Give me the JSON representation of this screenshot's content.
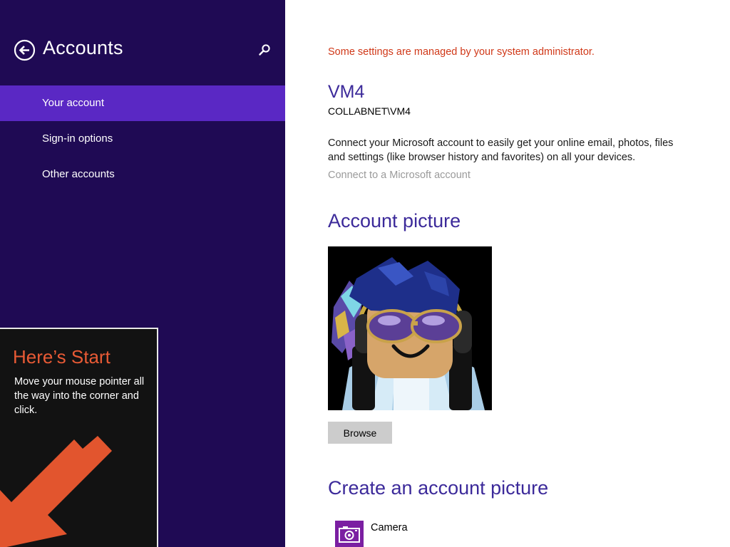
{
  "nav": {
    "title": "Accounts",
    "back_icon": "back-arrow-circle-icon",
    "search_icon": "search-icon",
    "items": [
      {
        "label": "Your account",
        "selected": true
      },
      {
        "label": "Sign-in options",
        "selected": false
      },
      {
        "label": "Other accounts",
        "selected": false
      }
    ]
  },
  "start_tip": {
    "title": "Here’s Start",
    "body": "Move your mouse pointer all the way into the corner and click.",
    "arrow_icon": "arrow-down-left-icon"
  },
  "account": {
    "admin_notice": "Some settings are managed by your system administrator.",
    "display_name": "VM4",
    "domain_user": "COLLABNET\\VM4",
    "connect_description": "Connect your Microsoft account to easily get your online email, photos, files and settings (like browser history and favorites) on all your devices.",
    "connect_link": "Connect to a Microsoft account"
  },
  "picture_section": {
    "heading": "Account picture",
    "browse_label": "Browse"
  },
  "create_section": {
    "heading": "Create an account picture",
    "camera_label": "Camera",
    "camera_icon": "camera-icon"
  },
  "colors": {
    "nav_background": "#1f0a54",
    "nav_selected": "#5a28c4",
    "accent_heading": "#3c2a9a",
    "admin_notice": "#d03818",
    "start_tip_accent": "#e85a35",
    "camera_tile": "#7b1fa2"
  }
}
